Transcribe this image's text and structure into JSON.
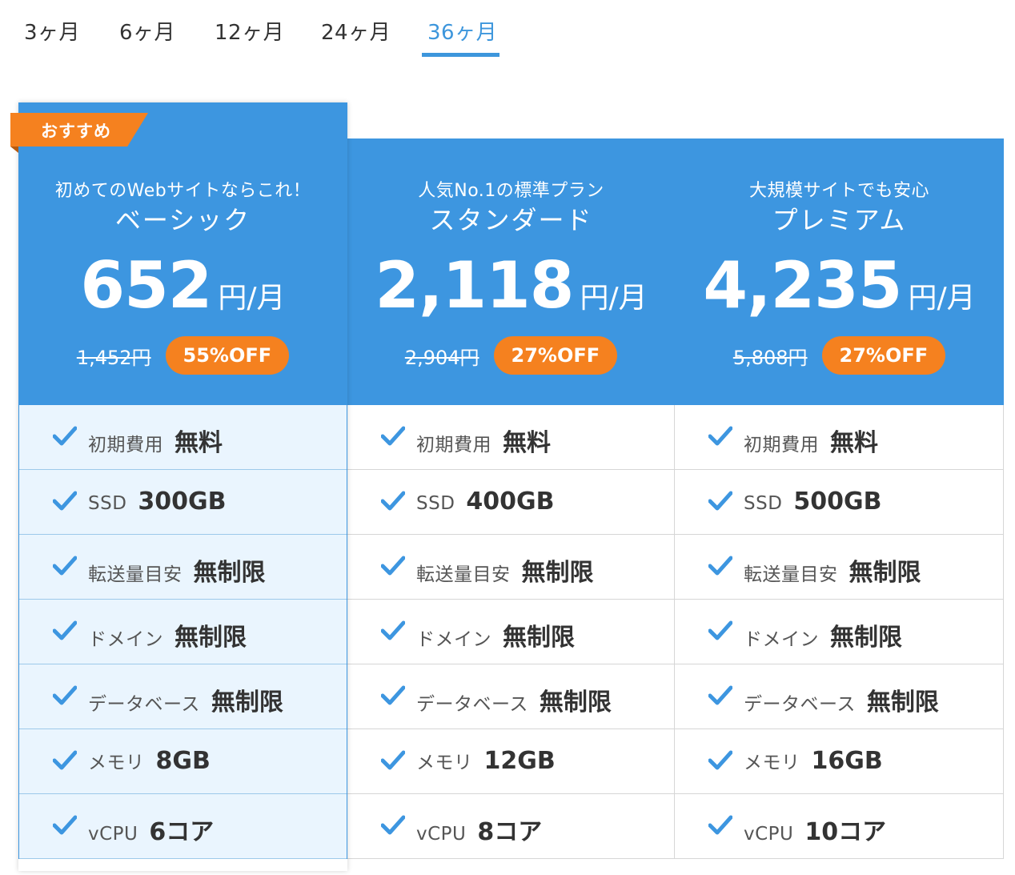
{
  "tabs": [
    {
      "label": "3ヶ月"
    },
    {
      "label": "6ヶ月"
    },
    {
      "label": "12ヶ月"
    },
    {
      "label": "24ヶ月"
    },
    {
      "label": "36ヶ月"
    }
  ],
  "active_tab": "36ヶ月",
  "ribbon": {
    "label": "おすすめ"
  },
  "plans": [
    {
      "tagline": "初めてのWebサイトならこれ！",
      "name": "ベーシック",
      "price": "652",
      "unit": "円/月",
      "original_price": "1,452円",
      "discount": "55%OFF",
      "features": [
        {
          "label": "初期費用",
          "value": "無料"
        },
        {
          "label": "SSD",
          "value": "300GB"
        },
        {
          "label": "転送量目安",
          "value": "無制限"
        },
        {
          "label": "ドメイン",
          "value": "無制限"
        },
        {
          "label": "データベース",
          "value": "無制限"
        },
        {
          "label": "メモリ",
          "value": "8GB"
        },
        {
          "label": "vCPU",
          "value": "6コア"
        }
      ]
    },
    {
      "tagline": "人気No.1の標準プラン",
      "name": "スタンダード",
      "price": "2,118",
      "unit": "円/月",
      "original_price": "2,904円",
      "discount": "27%OFF",
      "features": [
        {
          "label": "初期費用",
          "value": "無料"
        },
        {
          "label": "SSD",
          "value": "400GB"
        },
        {
          "label": "転送量目安",
          "value": "無制限"
        },
        {
          "label": "ドメイン",
          "value": "無制限"
        },
        {
          "label": "データベース",
          "value": "無制限"
        },
        {
          "label": "メモリ",
          "value": "12GB"
        },
        {
          "label": "vCPU",
          "value": "8コア"
        }
      ]
    },
    {
      "tagline": "大規模サイトでも安心",
      "name": "プレミアム",
      "price": "4,235",
      "unit": "円/月",
      "original_price": "5,808円",
      "discount": "27%OFF",
      "features": [
        {
          "label": "初期費用",
          "value": "無料"
        },
        {
          "label": "SSD",
          "value": "500GB"
        },
        {
          "label": "転送量目安",
          "value": "無制限"
        },
        {
          "label": "ドメイン",
          "value": "無制限"
        },
        {
          "label": "データベース",
          "value": "無制限"
        },
        {
          "label": "メモリ",
          "value": "16GB"
        },
        {
          "label": "vCPU",
          "value": "10コア"
        }
      ]
    }
  ],
  "colors": {
    "accent": "#3d96e0",
    "orange": "#f5811f",
    "highlight_bg": "#eaf5fe"
  },
  "icons": {
    "feature": "check-icon"
  }
}
